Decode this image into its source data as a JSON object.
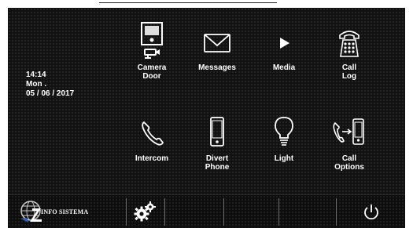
{
  "datetime": {
    "time": "14:14",
    "day": "Mon .",
    "date": "05 / 06 / 2017"
  },
  "tiles": [
    {
      "label_lines": [
        "Camera",
        "Door"
      ]
    },
    {
      "label_lines": [
        "Messages"
      ]
    },
    {
      "label_lines": [
        "Media"
      ]
    },
    {
      "label_lines": [
        "Call",
        "Log"
      ]
    },
    {
      "label_lines": [
        "Intercom"
      ]
    },
    {
      "label_lines": [
        "Divert",
        "Phone"
      ]
    },
    {
      "label_lines": [
        "Light"
      ]
    },
    {
      "label_lines": [
        "Call",
        "Options"
      ]
    }
  ],
  "bottombar": {
    "info_label": "INFO SISTEMA"
  }
}
